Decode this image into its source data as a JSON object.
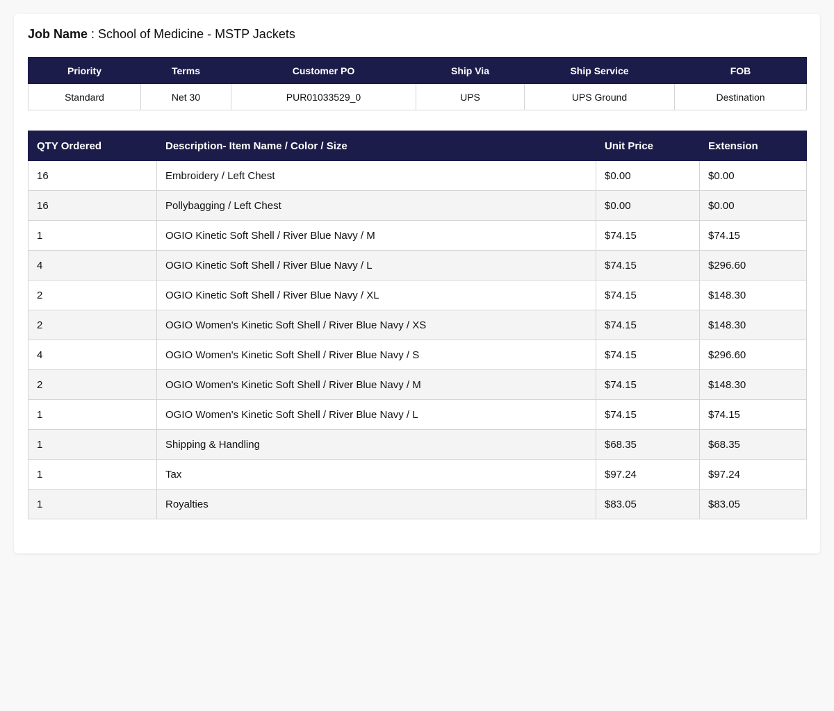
{
  "job": {
    "label": "Job Name",
    "separator": " : ",
    "value": "School of Medicine - MSTP Jackets"
  },
  "info": {
    "headers": [
      "Priority",
      "Terms",
      "Customer PO",
      "Ship Via",
      "Ship Service",
      "FOB"
    ],
    "values": [
      "Standard",
      "Net 30",
      "PUR01033529_0",
      "UPS",
      "UPS Ground",
      "Destination"
    ]
  },
  "items": {
    "headers": [
      "QTY Ordered",
      "Description- Item Name / Color / Size",
      "Unit Price",
      "Extension"
    ],
    "rows": [
      [
        "16",
        "Embroidery / Left Chest",
        "$0.00",
        "$0.00"
      ],
      [
        "16",
        "Pollybagging / Left Chest",
        "$0.00",
        "$0.00"
      ],
      [
        "1",
        "OGIO Kinetic Soft Shell / River Blue Navy / M",
        "$74.15",
        "$74.15"
      ],
      [
        "4",
        "OGIO Kinetic Soft Shell / River Blue Navy / L",
        "$74.15",
        "$296.60"
      ],
      [
        "2",
        "OGIO Kinetic Soft Shell / River Blue Navy / XL",
        "$74.15",
        "$148.30"
      ],
      [
        "2",
        "OGIO Women's Kinetic Soft Shell / River Blue Navy / XS",
        "$74.15",
        "$148.30"
      ],
      [
        "4",
        "OGIO Women's Kinetic Soft Shell / River Blue Navy / S",
        "$74.15",
        "$296.60"
      ],
      [
        "2",
        "OGIO Women's Kinetic Soft Shell / River Blue Navy / M",
        "$74.15",
        "$148.30"
      ],
      [
        "1",
        "OGIO Women's Kinetic Soft Shell / River Blue Navy / L",
        "$74.15",
        "$74.15"
      ],
      [
        "1",
        "Shipping & Handling",
        "$68.35",
        "$68.35"
      ],
      [
        "1",
        "Tax",
        "$97.24",
        "$97.24"
      ],
      [
        "1",
        "Royalties",
        "$83.05",
        "$83.05"
      ]
    ]
  },
  "colors": {
    "header_bg": "#1c1c4a",
    "header_text": "#ffffff",
    "row_alt": "#f4f4f4",
    "border": "#d4d4d4"
  }
}
